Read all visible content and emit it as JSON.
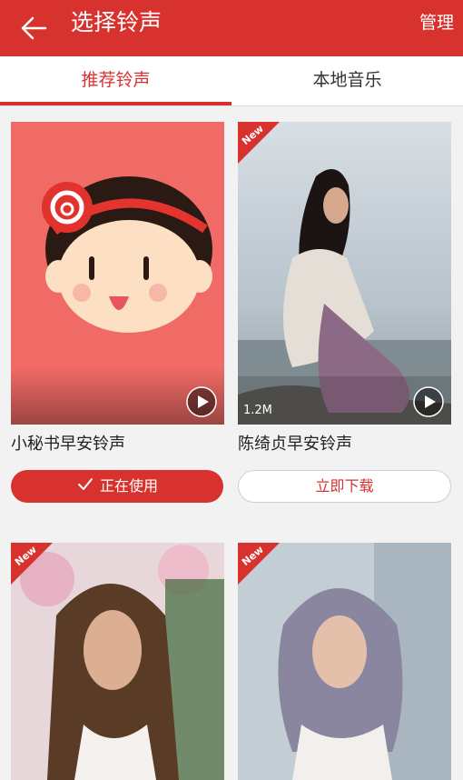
{
  "header": {
    "title": "选择铃声",
    "manage_label": "管理"
  },
  "tabs": [
    {
      "label": "推荐铃声",
      "active": true
    },
    {
      "label": "本地音乐",
      "active": false
    }
  ],
  "cards": [
    {
      "title": "小秘书早安铃声",
      "action": "正在使用",
      "state": "using",
      "badge": ""
    },
    {
      "title": "陈绮贞早安铃声",
      "action": "立即下载",
      "state": "download",
      "badge": "New",
      "size": "1.2M"
    },
    {
      "badge": "New"
    },
    {
      "badge": "New"
    }
  ],
  "colors": {
    "accent": "#d8322e",
    "card1_bg": "#f06a66"
  }
}
